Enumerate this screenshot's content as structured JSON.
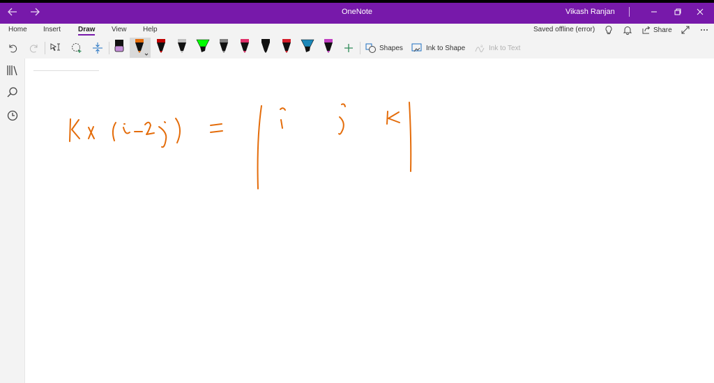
{
  "window": {
    "app_title": "OneNote",
    "user_name": "Vikash Ranjan",
    "title_bar_color": "#7719aa"
  },
  "ribbon_tabs": {
    "home": "Home",
    "insert": "Insert",
    "draw": "Draw",
    "view": "View",
    "help": "Help",
    "status": "Saved offline (error)",
    "share": "Share"
  },
  "draw_toolbar": {
    "shapes_label": "Shapes",
    "ink_to_shape_label": "Ink to Shape",
    "ink_to_text_label": "Ink to Text",
    "pens": [
      {
        "name": "highlighter-lilac",
        "color": "#c58fd9"
      },
      {
        "name": "pen-orange",
        "color": "#e46c0a",
        "selected": true
      },
      {
        "name": "pen-dark-red",
        "color": "#c00000"
      },
      {
        "name": "pen-silver",
        "color": "#bfbfbf"
      },
      {
        "name": "highlighter-green",
        "color": "#00ff00"
      },
      {
        "name": "pen-gray-pattern",
        "color": "#808080"
      },
      {
        "name": "pen-pink",
        "color": "#e0306a"
      },
      {
        "name": "pen-black",
        "color": "#111111"
      },
      {
        "name": "pen-red",
        "color": "#d41e2b"
      },
      {
        "name": "highlighter-teal",
        "color": "#1b87b8"
      },
      {
        "name": "pen-galaxy",
        "color": "#c03fc0"
      }
    ]
  },
  "ink": {
    "color": "#e46c0a"
  }
}
